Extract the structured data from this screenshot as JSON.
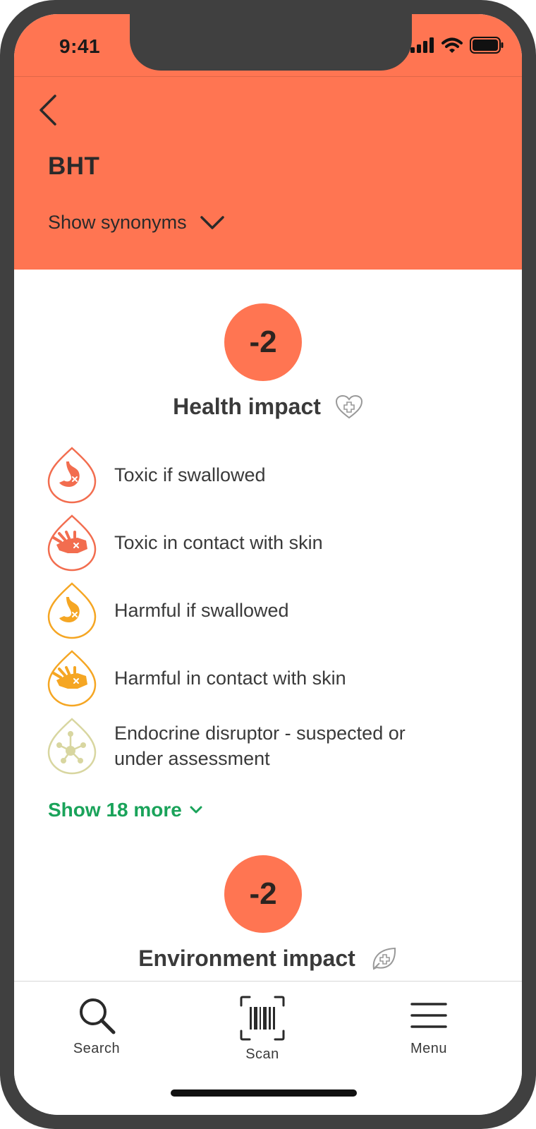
{
  "status_bar": {
    "time": "9:41"
  },
  "header": {
    "title": "BHT",
    "synonyms_label": "Show synonyms",
    "background": "#ff7552"
  },
  "health": {
    "score": "-2",
    "title": "Health impact",
    "hazards": [
      {
        "label": "Toxic if swallowed",
        "icon": "stomach-icon",
        "color": "#f26d4f"
      },
      {
        "label": "Toxic in contact with skin",
        "icon": "hand-icon",
        "color": "#f26d4f"
      },
      {
        "label": "Harmful if swallowed",
        "icon": "stomach-icon",
        "color": "#f5a623"
      },
      {
        "label": "Harmful in contact with skin",
        "icon": "hand-icon",
        "color": "#f5a623"
      },
      {
        "label_line1": "Endocrine disruptor - suspected or",
        "label_line2": "under assessment",
        "icon": "molecule-icon",
        "color": "#d8d6a0"
      }
    ],
    "show_more_label": "Show 18 more"
  },
  "environment": {
    "score": "-2",
    "title": "Environment impact"
  },
  "tabbar": {
    "search_label": "Search",
    "scan_label": "Scan",
    "menu_label": "Menu"
  },
  "colors": {
    "accent": "#ff7552",
    "toxic": "#f26d4f",
    "harmful": "#f5a623",
    "endocrine": "#d8d6a0",
    "link": "#1aa35a"
  }
}
